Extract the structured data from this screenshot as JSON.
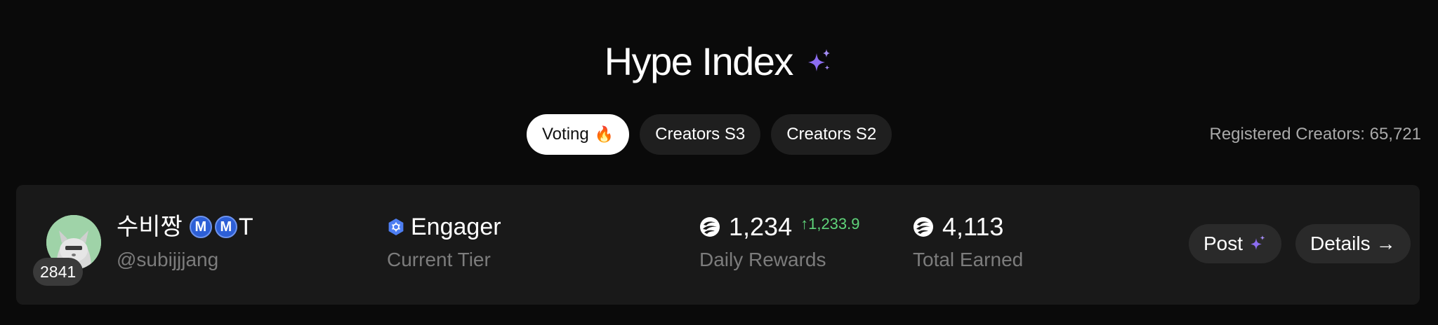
{
  "header": {
    "title": "Hype Index",
    "sparkle_icon": "sparkle-icon",
    "accent_color": "#8b6cf0"
  },
  "tabs": [
    {
      "label": "Voting",
      "emoji": "🔥",
      "active": true
    },
    {
      "label": "Creators S3",
      "active": false
    },
    {
      "label": "Creators S2",
      "active": false
    }
  ],
  "registered_creators": "Registered Creators: 65,721",
  "creator": {
    "rank": "2841",
    "name": "수비짱",
    "badges": [
      "M",
      "M"
    ],
    "name_suffix": "T",
    "handle": "@subijjjang",
    "tier": "Engager",
    "tier_label": "Current Tier",
    "tier_icon": "hexagon-tier-icon",
    "daily_rewards": "1,234",
    "daily_delta": "↑1,233.9",
    "daily_rewards_label": "Daily Rewards",
    "total_earned": "4,113",
    "total_earned_label": "Total Earned",
    "delta_color": "#5fd47a"
  },
  "actions": {
    "post_label": "Post",
    "details_label": "Details",
    "details_arrow": "→"
  }
}
